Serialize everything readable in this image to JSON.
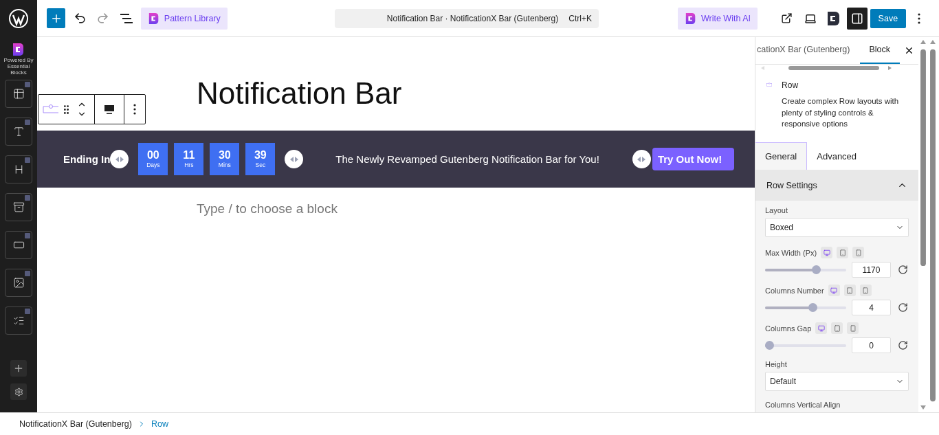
{
  "topbar": {
    "pattern_library": "Pattern Library",
    "document_title": "Notification Bar · NotificationX Bar (Gutenberg)",
    "shortcut": "Ctrl+K",
    "write_ai": "Write With AI",
    "save": "Save"
  },
  "rail": {
    "brand_caption": "Powered By Essential Blocks"
  },
  "canvas": {
    "title": "Notification Bar",
    "notification": {
      "label": "Ending In",
      "timer": [
        {
          "value": "00",
          "unit": "Days"
        },
        {
          "value": "11",
          "unit": "Hrs"
        },
        {
          "value": "30",
          "unit": "Mins"
        },
        {
          "value": "39",
          "unit": "Sec"
        }
      ],
      "message": "The Newly Revamped Gutenberg Notification Bar for You!",
      "button": "Try Out Now!"
    },
    "placeholder": "Type / to choose a block"
  },
  "sidebar": {
    "tabs": [
      {
        "label": "cationX Bar (Gutenberg)",
        "selected": false
      },
      {
        "label": "Block",
        "selected": true
      }
    ],
    "block": {
      "name": "Row",
      "description": "Create complex Row layouts with plenty of styling controls & responsive options"
    },
    "panel_tabs": [
      {
        "label": "General",
        "selected": true
      },
      {
        "label": "Advanced",
        "selected": false
      }
    ],
    "section": {
      "title": "Row Settings",
      "expanded": true
    },
    "fields": [
      {
        "kind": "select",
        "label": "Layout",
        "value": "Boxed"
      },
      {
        "kind": "slider",
        "label": "Max Width (Px)",
        "level": 0.65,
        "value": "1170",
        "devices": [
          {
            "selected": true
          },
          {
            "selected": false
          },
          {
            "selected": false
          }
        ]
      },
      {
        "kind": "slider",
        "label": "Columns Number",
        "level": 0.6,
        "value": "4",
        "devices": [
          {
            "selected": true
          },
          {
            "selected": false
          },
          {
            "selected": false
          }
        ]
      },
      {
        "kind": "slider",
        "label": "Columns Gap",
        "level": 0,
        "value": "0",
        "devices": [
          {
            "selected": true
          },
          {
            "selected": false
          },
          {
            "selected": false
          }
        ]
      },
      {
        "kind": "select",
        "label": "Height",
        "value": "Default"
      },
      {
        "kind": "heading",
        "label": "Columns Vertical Align"
      }
    ]
  },
  "breadcrumb": [
    {
      "label": "NotificationX Bar (Gutenberg)",
      "selected": false
    },
    {
      "label": "Row",
      "selected": true
    }
  ]
}
